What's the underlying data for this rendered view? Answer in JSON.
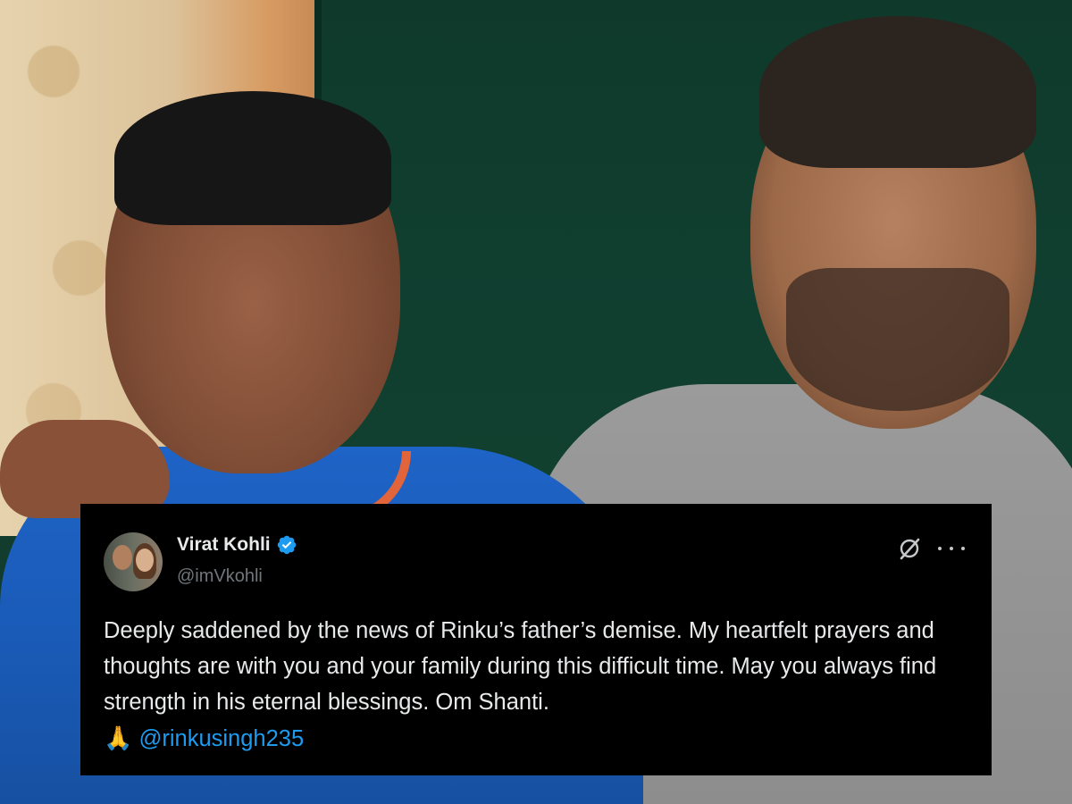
{
  "tweet": {
    "author_name": "Virat Kohli",
    "handle": "@imVkohli",
    "verified": true,
    "text": "Deeply saddened by the news of Rinku’s father’s demise. My heartfelt prayers and thoughts are with you and your family during this difficult time. May you always find strength in his eternal blessings. Om Shanti.",
    "emoji": "🙏",
    "mention": "@rinkusingh235",
    "icons": [
      "grok-icon",
      "more-options-icon",
      "verified-badge-icon"
    ]
  },
  "colors": {
    "card_background": "#000000",
    "text": "#e7e9ea",
    "handle": "#71767b",
    "mention": "#1d9bf0",
    "verified": "#1d9bf0"
  }
}
